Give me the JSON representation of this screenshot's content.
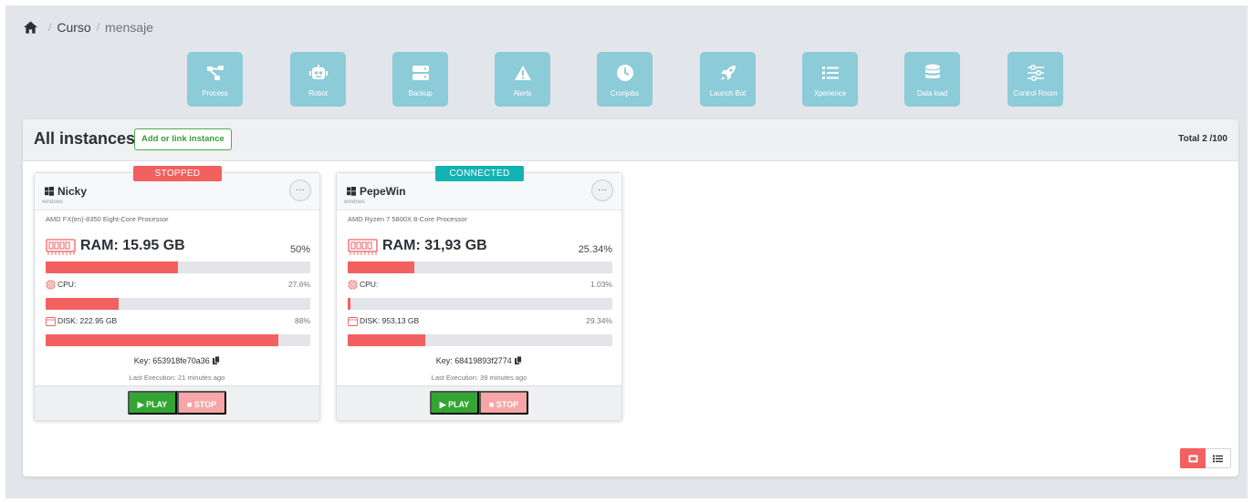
{
  "breadcrumb": {
    "items": [
      "Curso",
      "mensaje"
    ],
    "separator": "/"
  },
  "modules": [
    {
      "label": "Process",
      "icon": "process-icon"
    },
    {
      "label": "Robot",
      "icon": "robot-icon"
    },
    {
      "label": "Backup",
      "icon": "backup-icon"
    },
    {
      "label": "Alerts",
      "icon": "alert-icon"
    },
    {
      "label": "Cronjobs",
      "icon": "clock-icon"
    },
    {
      "label": "Launch Bot",
      "icon": "rocket-icon"
    },
    {
      "label": "Xperience",
      "icon": "list-icon"
    },
    {
      "label": "Data load",
      "icon": "database-icon"
    },
    {
      "label": "Control Room",
      "icon": "sliders-icon"
    }
  ],
  "panel": {
    "title": "All instances",
    "add_label": "Add or link instance",
    "total": "Total 2 /100"
  },
  "instances": [
    {
      "status": "STOPPED",
      "name": "Nicky",
      "os": "windows",
      "more": "···",
      "cpu_model": "AMD FX(tm)-8350 Eight-Core Processor",
      "ram_label": "RAM: 15.95 GB",
      "ram_pct": "50%",
      "ram_fraction": 0.5,
      "cpu_label": "CPU:",
      "cpu_pct": "27.6%",
      "cpu_fraction": 0.276,
      "disk_label": "DISK: 222.95 GB",
      "disk_pct": "88%",
      "disk_fraction": 0.88,
      "key": "Key: 653918fe70a36",
      "last_execution": "Last Execution: 21 minutes ago",
      "play_label": "▶ PLAY",
      "stop_label": "■ STOP"
    },
    {
      "status": "CONNECTED",
      "name": "PepeWin",
      "os": "windows",
      "more": "···",
      "cpu_model": "AMD Ryzen 7 5800X 8-Core Processor",
      "ram_label": "RAM: 31,93 GB",
      "ram_pct": "25.34%",
      "ram_fraction": 0.2534,
      "cpu_label": "CPU:",
      "cpu_pct": "1.03%",
      "cpu_fraction": 0.0103,
      "disk_label": "DISK: 953,13 GB",
      "disk_pct": "29.34%",
      "disk_fraction": 0.2934,
      "key": "Key: 68419893f2774",
      "last_execution": "Last Execution: 39 minutes ago",
      "play_label": "▶ PLAY",
      "stop_label": "■ STOP"
    }
  ],
  "colors": {
    "tile": "#8ccbd8",
    "stopped": "#f26060",
    "connected": "#14b3b3",
    "play": "#33a533",
    "stop": "#f6a6a6",
    "bar_fill": "#f26060"
  }
}
